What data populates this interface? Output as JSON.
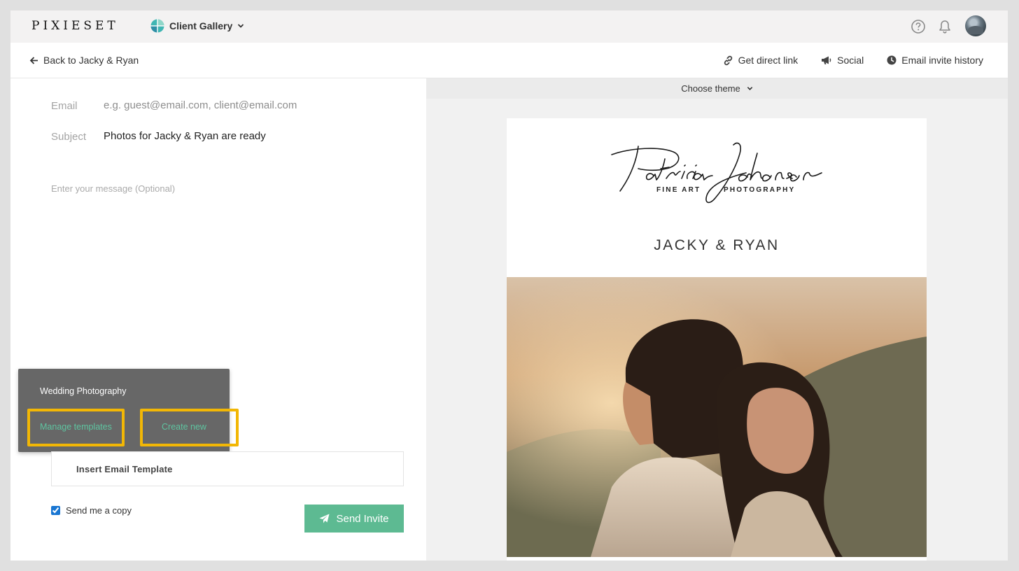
{
  "topbar": {
    "logo": "PIXIESET",
    "product": "Client Gallery"
  },
  "subbar": {
    "back_label": "Back to Jacky & Ryan",
    "actions": [
      "Get direct link",
      "Social",
      "Email invite history"
    ]
  },
  "form": {
    "email_label": "Email",
    "email_placeholder": "e.g. guest@email.com, client@email.com",
    "email_value": "",
    "subject_label": "Subject",
    "subject_value": "Photos for Jacky & Ryan are ready",
    "message_placeholder": "Enter your message (Optional)"
  },
  "template_popup": {
    "items": [
      "Wedding Photography"
    ],
    "manage_label": "Manage templates",
    "create_label": "Create new",
    "highlight_color": "#f2b705"
  },
  "insert_template_label": "Insert Email Template",
  "send_copy": {
    "label": "Send me a copy",
    "checked": true
  },
  "send_button": {
    "label": "Send Invite",
    "color": "#5dba92"
  },
  "preview": {
    "theme_label": "Choose theme",
    "brand_signature": "Patricia Johnson",
    "brand_sub_left": "FINE ART",
    "brand_sub_right": "PHOTOGRAPHY",
    "couple_title": "JACKY & RYAN"
  }
}
